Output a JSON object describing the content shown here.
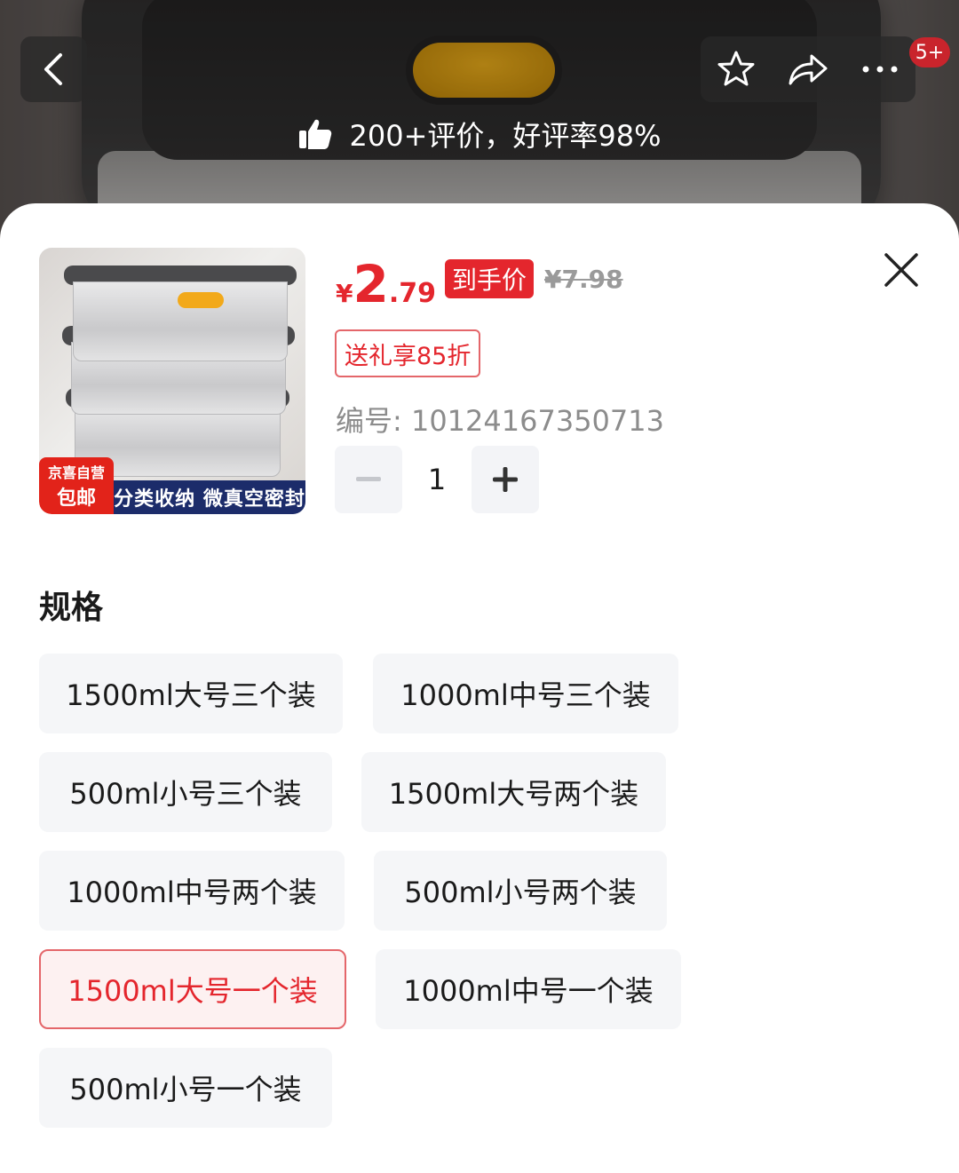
{
  "header": {
    "cart_badge": "5+",
    "rating_text": "200+评价，好评率98%"
  },
  "product": {
    "image_badge_top": "京喜自营",
    "image_badge_bottom": "包邮",
    "image_caption": "分类收纳 微真空密封",
    "price_symbol": "¥",
    "price_int": "2",
    "price_dec": ".79",
    "final_price_tag": "到手价",
    "original_price": "¥7.98",
    "coupon": "送礼享85折",
    "sku": "编号: 10124167350713",
    "quantity": "1"
  },
  "spec": {
    "title": "规格",
    "options": [
      "1500ml大号三个装",
      "1000ml中号三个装",
      "500ml小号三个装",
      "1500ml大号两个装",
      "1000ml中号两个装",
      "500ml小号两个装",
      "1500ml大号一个装",
      "1000ml中号一个装",
      "500ml小号一个装"
    ],
    "selected": "1500ml大号一个装"
  },
  "colors": {
    "accent": "#e4262d",
    "option_bg": "#f5f6f8",
    "selected_bg": "#fdf1f1"
  },
  "icons": [
    "back-icon",
    "star-icon",
    "share-icon",
    "more-icon",
    "thumbs-up-icon",
    "close-icon",
    "minus-icon",
    "plus-icon"
  ]
}
